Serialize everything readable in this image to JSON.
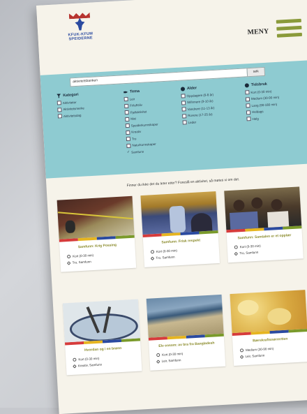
{
  "header": {
    "logo_line1": "KFUK-KFUM",
    "logo_line2": "SPEIDERNE",
    "menu_label": "MENY"
  },
  "search": {
    "value": "aktivitetsbanken",
    "button_label": "søk"
  },
  "filters": {
    "kategori": {
      "title": "Kategori",
      "items": [
        "Aktiviteter",
        "Aktivitetsmerke",
        "Aktivitetsdag"
      ]
    },
    "tema": {
      "title": "Tema",
      "items": [
        "Leir",
        "Friluftsliv",
        "Fjellaktivitet",
        "Mat",
        "Speiderkunnskaper",
        "Kreativ",
        "Tro",
        "Naturkunnskaper"
      ],
      "checked_item": "Samfunn"
    },
    "alder": {
      "title": "Alder",
      "items": [
        "Oppdagere (6-8 år)",
        "Stifinnere (9-10 år)",
        "Vandrere (11-13 år)",
        "Rovere (17-25 år)",
        "Leder"
      ]
    },
    "tidsbruk": {
      "title": "Tidsbruk",
      "items": [
        "Kort (0-30 min)",
        "Medium (30-90 min)",
        "Lang (90-180 min)",
        "Heldags",
        "Helg"
      ]
    }
  },
  "question": "Finner du ikke det du leter etter? Foreslå en aktivitet, så møtes vi om det.",
  "cards": [
    {
      "title": "Samfunn: Krig Possing",
      "time": "Kort (0-30 min)",
      "tag": "Tro, Samfunn"
    },
    {
      "title": "Samfunn: Frisk respekt",
      "time": "Kort (0-30 min)",
      "tag": "Tro, Samfunn"
    },
    {
      "title": "Samfunn: Samtalen er et opplær",
      "time": "Kort (0-30 min)",
      "tag": "Tro, Samfunn"
    },
    {
      "title": "Hvordan og i en brønn",
      "time": "Kort (0-30 min)",
      "tag": "Kreativ, Samfunn"
    },
    {
      "title": "Elv ensom: av bra fra Bangladesh",
      "time": "Kort (0-30 min)",
      "tag": "Leir, Samfunn"
    },
    {
      "title": "Bærekraftsnørrertten",
      "time": "Medium (30-90 min)",
      "tag": "Leir, Samfunn"
    }
  ],
  "stripe_colors": [
    "#d63b3b",
    "#e6b520",
    "#2a4aa0",
    "#7a9a2a"
  ]
}
